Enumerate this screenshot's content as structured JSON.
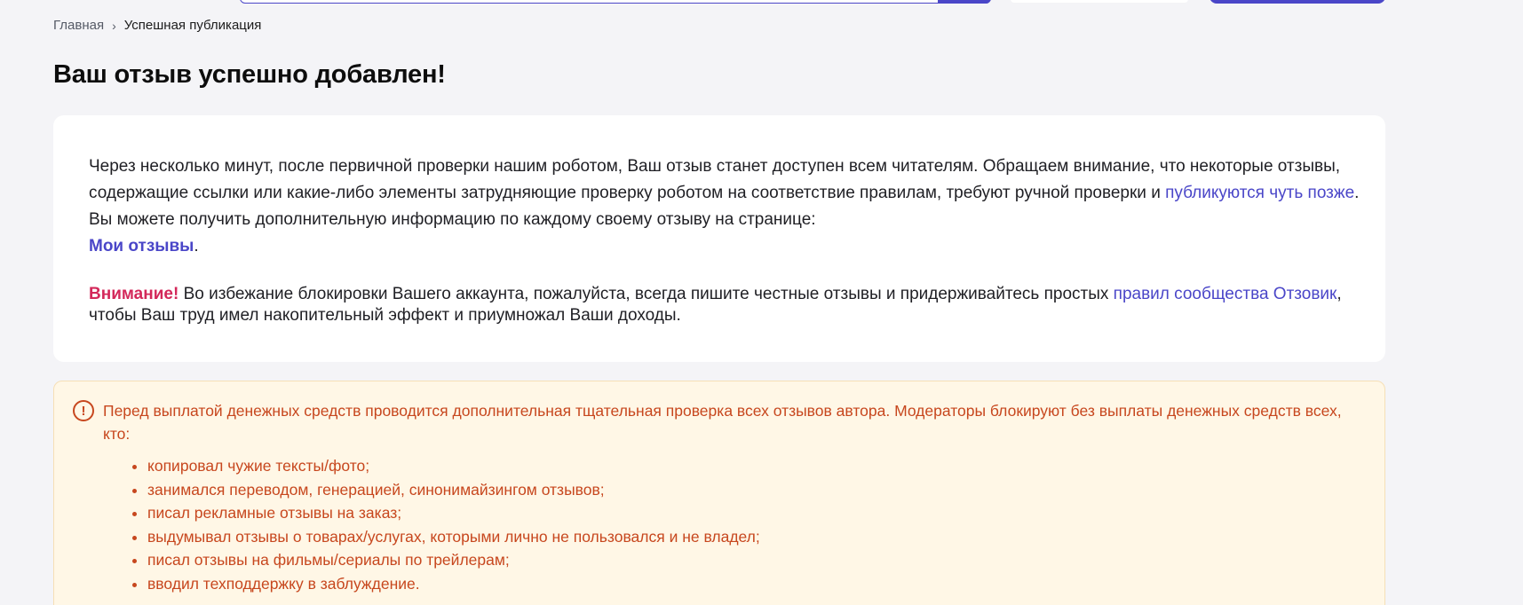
{
  "breadcrumb": {
    "home": "Главная",
    "separator": "›",
    "current": "Успешная публикация"
  },
  "page_title": "Ваш отзыв успешно добавлен!",
  "info": {
    "text_part1": "Через несколько минут, после первичной проверки нашим роботом, Ваш отзыв станет доступен всем читателям. Обращаем внимание, что некоторые отзывы, содержащие ссылки или какие-либо элементы затрудняющие проверку роботом на соответствие правилам, требуют ручной проверки и ",
    "later_link": "публикуются чуть позже",
    "text_part2": ". Вы можете получить дополнительную информацию по каждому своему отзыву на странице: ",
    "my_reviews_link": "Мои отзывы",
    "text_part3": "."
  },
  "attention": {
    "label": "Внимание!",
    "text_part1": " Во избежание блокировки Вашего аккаунта, пожалуйста, всегда пишите честные отзывы и придерживайтесь простых ",
    "rules_link": "правил сообщества Отзовик",
    "text_part2": ", чтобы Ваш труд имел накопительный эффект и приумножал Ваши доходы."
  },
  "warning": {
    "icon": "exclamation-circle-icon",
    "icon_glyph": "!",
    "text": "Перед выплатой денежных средств проводится дополнительная тщательная проверка всех отзывов автора. Модераторы блокируют без выплаты денежных средств всех, кто:",
    "items": [
      "копировал чужие тексты/фото;",
      "занимался переводом, генерацией, синонимайзингом отзывов;",
      "писал рекламные отзывы на заказ;",
      "выдумывал отзывы о товарах/услугах, которыми лично не пользовался и не владел;",
      "писал отзывы на фильмы/сериалы по трейлерам;",
      "вводил техподдержку в заблуждение."
    ]
  },
  "colors": {
    "accent": "#4a46c8",
    "attention": "#d3285a",
    "warning_text": "#c7471e",
    "warning_bg": "#fff7e6",
    "page_bg": "#f4f4f7"
  }
}
